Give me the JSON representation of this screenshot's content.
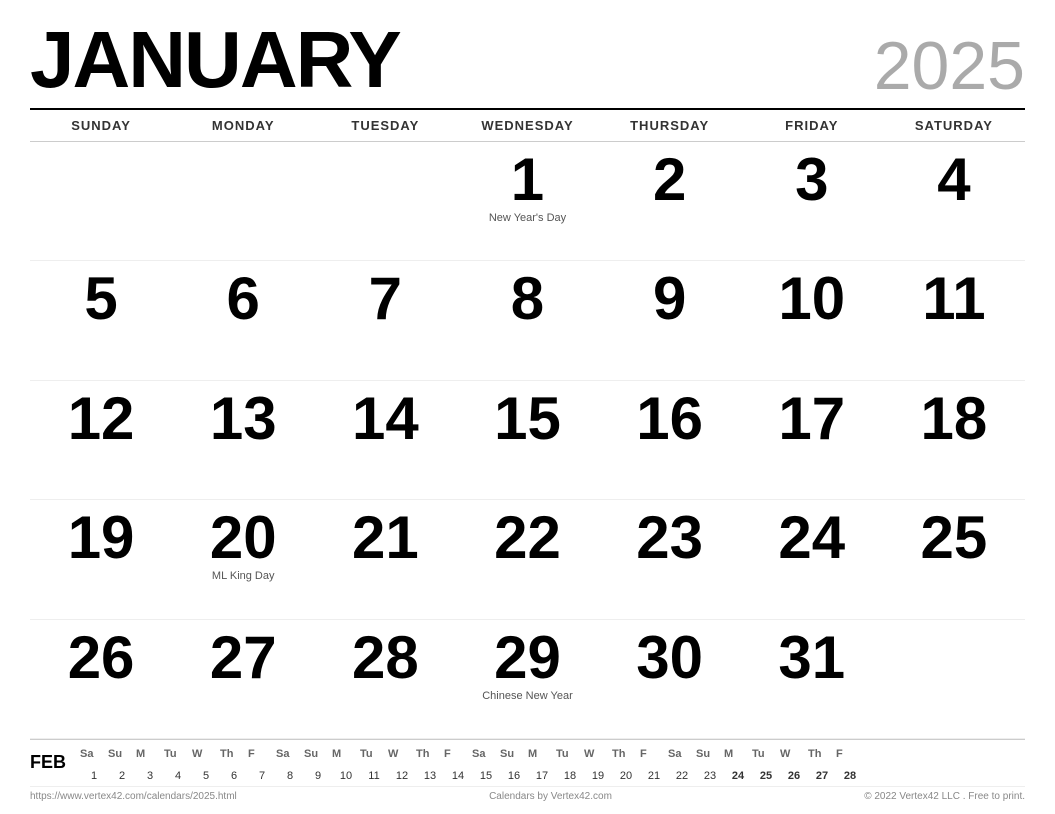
{
  "header": {
    "month": "JANUARY",
    "year": "2025"
  },
  "day_headers": [
    "SUNDAY",
    "MONDAY",
    "TUESDAY",
    "WEDNESDAY",
    "THURSDAY",
    "FRIDAY",
    "SATURDAY"
  ],
  "weeks": [
    [
      {
        "num": "",
        "holiday": ""
      },
      {
        "num": "",
        "holiday": ""
      },
      {
        "num": "",
        "holiday": ""
      },
      {
        "num": "1",
        "holiday": "New Year's Day"
      },
      {
        "num": "2",
        "holiday": ""
      },
      {
        "num": "3",
        "holiday": ""
      },
      {
        "num": "4",
        "holiday": ""
      }
    ],
    [
      {
        "num": "5",
        "holiday": ""
      },
      {
        "num": "6",
        "holiday": ""
      },
      {
        "num": "7",
        "holiday": ""
      },
      {
        "num": "8",
        "holiday": ""
      },
      {
        "num": "9",
        "holiday": ""
      },
      {
        "num": "10",
        "holiday": ""
      },
      {
        "num": "11",
        "holiday": ""
      }
    ],
    [
      {
        "num": "12",
        "holiday": ""
      },
      {
        "num": "13",
        "holiday": ""
      },
      {
        "num": "14",
        "holiday": ""
      },
      {
        "num": "15",
        "holiday": ""
      },
      {
        "num": "16",
        "holiday": ""
      },
      {
        "num": "17",
        "holiday": ""
      },
      {
        "num": "18",
        "holiday": ""
      }
    ],
    [
      {
        "num": "19",
        "holiday": ""
      },
      {
        "num": "20",
        "holiday": "ML King Day"
      },
      {
        "num": "21",
        "holiday": ""
      },
      {
        "num": "22",
        "holiday": ""
      },
      {
        "num": "23",
        "holiday": ""
      },
      {
        "num": "24",
        "holiday": ""
      },
      {
        "num": "25",
        "holiday": ""
      }
    ],
    [
      {
        "num": "26",
        "holiday": ""
      },
      {
        "num": "27",
        "holiday": ""
      },
      {
        "num": "28",
        "holiday": ""
      },
      {
        "num": "29",
        "holiday": "Chinese New Year"
      },
      {
        "num": "30",
        "holiday": ""
      },
      {
        "num": "31",
        "holiday": ""
      },
      {
        "num": "",
        "holiday": ""
      }
    ]
  ],
  "mini_cal": {
    "month_label": "FEB",
    "headers": [
      "Sa",
      "Su",
      "M",
      "Tu",
      "W",
      "Th",
      "F",
      "Sa",
      "Su",
      "M",
      "Tu",
      "W",
      "Th",
      "F",
      "Sa",
      "Su",
      "M",
      "Tu",
      "W",
      "Th",
      "F",
      "Sa",
      "Su",
      "M",
      "Tu",
      "W",
      "Th",
      "F"
    ],
    "dates": [
      "1",
      "2",
      "3",
      "4",
      "5",
      "6",
      "7",
      "8",
      "9",
      "10",
      "11",
      "12",
      "13",
      "14",
      "15",
      "16",
      "17",
      "18",
      "19",
      "20",
      "21",
      "22",
      "23",
      "24",
      "25",
      "26",
      "27",
      "28"
    ]
  },
  "footer": {
    "left": "https://www.vertex42.com/calendars/2025.html",
    "center": "Calendars by Vertex42.com",
    "right": "© 2022 Vertex42 LLC . Free to print."
  }
}
